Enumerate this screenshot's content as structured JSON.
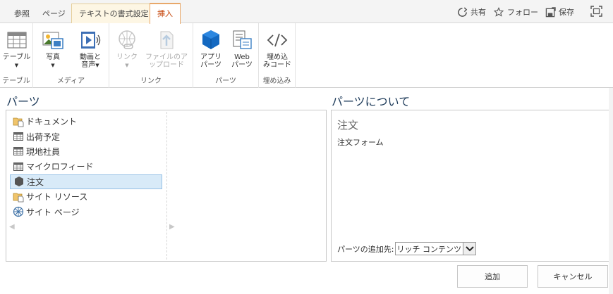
{
  "tabs": [
    {
      "label": "参照"
    },
    {
      "label": "ページ"
    },
    {
      "label": "テキストの書式設定"
    },
    {
      "label": "挿入"
    }
  ],
  "top_actions": {
    "share": "共有",
    "follow": "フォロー",
    "save": "保存"
  },
  "ribbon": {
    "table_group": {
      "label": "テーブル",
      "table_btn": "テーブル"
    },
    "media_group": {
      "label": "メディア",
      "photo_btn": "写真",
      "video_btn_line1": "動画と",
      "video_btn_line2": "音声"
    },
    "link_group": {
      "label": "リンク",
      "link_btn": "リンク",
      "upload_btn_line1": "ファイルのア",
      "upload_btn_line2": "ップロード"
    },
    "parts_group": {
      "label": "パーツ",
      "app_btn_line1": "アプリ",
      "app_btn_line2": "パーツ",
      "web_btn_line1": "Web",
      "web_btn_line2": "パーツ"
    },
    "embed_group": {
      "label": "埋め込み",
      "embed_btn_line1": "埋め込",
      "embed_btn_line2": "みコード"
    }
  },
  "parts_panel": {
    "title": "パーツ",
    "items": [
      {
        "label": "ドキュメント",
        "icon": "library-icon"
      },
      {
        "label": "出荷予定",
        "icon": "list-icon"
      },
      {
        "label": "現地社員",
        "icon": "list-icon"
      },
      {
        "label": "マイクロフィード",
        "icon": "list-icon"
      },
      {
        "label": "注文",
        "icon": "app-icon",
        "selected": true
      },
      {
        "label": "サイト リソース",
        "icon": "library-icon"
      },
      {
        "label": "サイト ページ",
        "icon": "wiki-icon"
      }
    ]
  },
  "about_panel": {
    "title": "パーツについて",
    "name": "注文",
    "description": "注文フォーム",
    "add_to_label": "パーツの追加先:",
    "add_to_value": "リッチ コンテンツ"
  },
  "footer": {
    "add": "追加",
    "cancel": "キャンセル"
  },
  "colors": {
    "accent": "#e8a86a",
    "active_tab_text": "#c33e00",
    "title": "#1e3b5a",
    "selection": "#d8eaf8"
  }
}
